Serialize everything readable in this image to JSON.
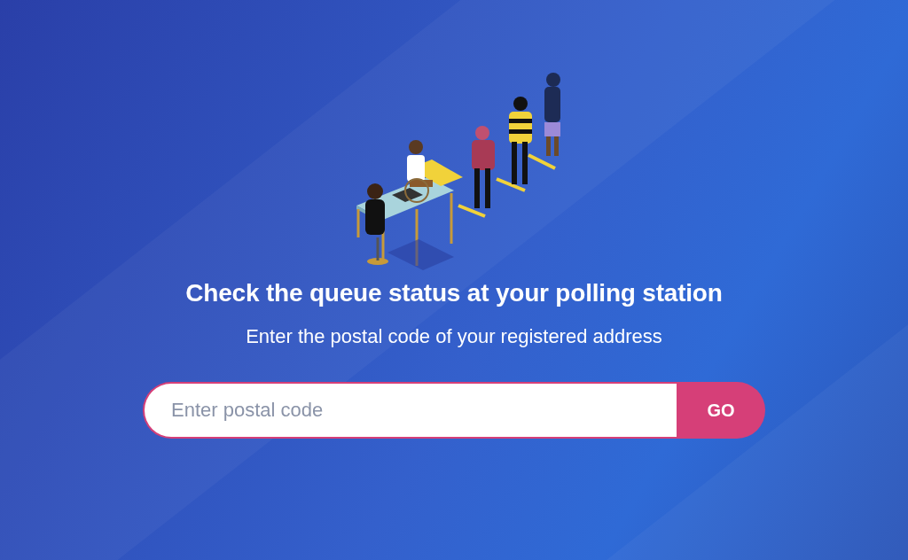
{
  "heading": "Check the queue status at your polling station",
  "subheading": "Enter the postal code of your registered address",
  "search": {
    "placeholder": "Enter postal code"
  },
  "button": "GO"
}
